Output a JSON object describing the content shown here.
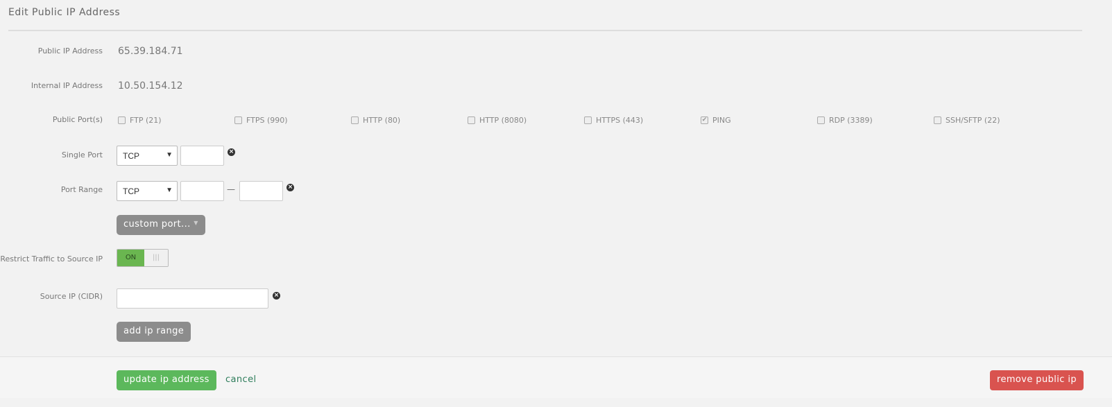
{
  "title": "Edit Public IP Address",
  "fields": {
    "public_ip_label": "Public IP Address",
    "public_ip": "65.39.184.71",
    "internal_ip_label": "Internal IP Address",
    "internal_ip": "10.50.154.12",
    "ports_label": "Public Port(s)",
    "ports": [
      {
        "label": "FTP (21)",
        "checked": false
      },
      {
        "label": "FTPS (990)",
        "checked": false
      },
      {
        "label": "HTTP (80)",
        "checked": false
      },
      {
        "label": "HTTP (8080)",
        "checked": false
      },
      {
        "label": "HTTPS (443)",
        "checked": false
      },
      {
        "label": "PING",
        "checked": true
      },
      {
        "label": "RDP (3389)",
        "checked": false
      },
      {
        "label": "SSH/SFTP (22)",
        "checked": false
      }
    ],
    "single_port_label": "Single Port",
    "single_port_protocol": "TCP",
    "single_port_value": "",
    "port_range_label": "Port Range",
    "port_range_protocol": "TCP",
    "port_range_from": "",
    "port_range_to": "",
    "range_dash": "—",
    "custom_port_label": "custom port...",
    "restrict_label": "Restrict Traffic to Source IP",
    "restrict_state": "ON",
    "restrict_off_glyph": "|||",
    "source_ip_label": "Source IP (CIDR)",
    "source_ip_value": "",
    "add_ip_range_label": "add ip range"
  },
  "footer": {
    "update_label": "update ip address",
    "cancel_label": "cancel",
    "remove_label": "remove public ip"
  },
  "colors": {
    "success": "#5cb85c",
    "danger": "#d9534f",
    "link": "#2e7d5b",
    "neutral": "#8c8c8c"
  },
  "icons": {
    "clear": "close-circle-icon",
    "dropdown": "caret-down-icon",
    "check": "checkmark-icon"
  }
}
